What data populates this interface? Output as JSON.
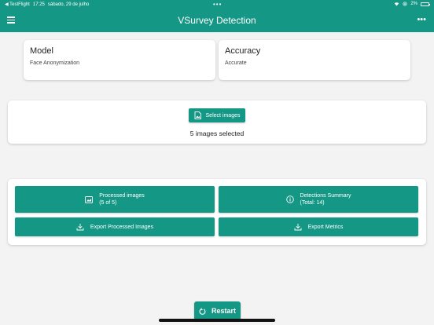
{
  "status_bar": {
    "back_app": "◀ TestFlight",
    "time": "17:25",
    "date": "sábado, 29 de julho",
    "battery_percent": "2%"
  },
  "header": {
    "title": "VSurvey Detection"
  },
  "model_card": {
    "label": "Model",
    "value": "Face Anonymization"
  },
  "accuracy_card": {
    "label": "Accuracy",
    "value": "Accurate"
  },
  "select": {
    "button_label": "Select images",
    "status": "5 images selected"
  },
  "actions": {
    "processed_line1": "Processed images",
    "processed_line2": "(5 of 5)",
    "summary_line1": "Detections Summary",
    "summary_line2": "(Total: 14)",
    "export_images": "Export Processed Images",
    "export_metrics": "Export Metrics"
  },
  "restart": {
    "label": "Restart"
  },
  "colors": {
    "accent": "#159786",
    "background": "#f3f3f3",
    "card": "#ffffff"
  }
}
